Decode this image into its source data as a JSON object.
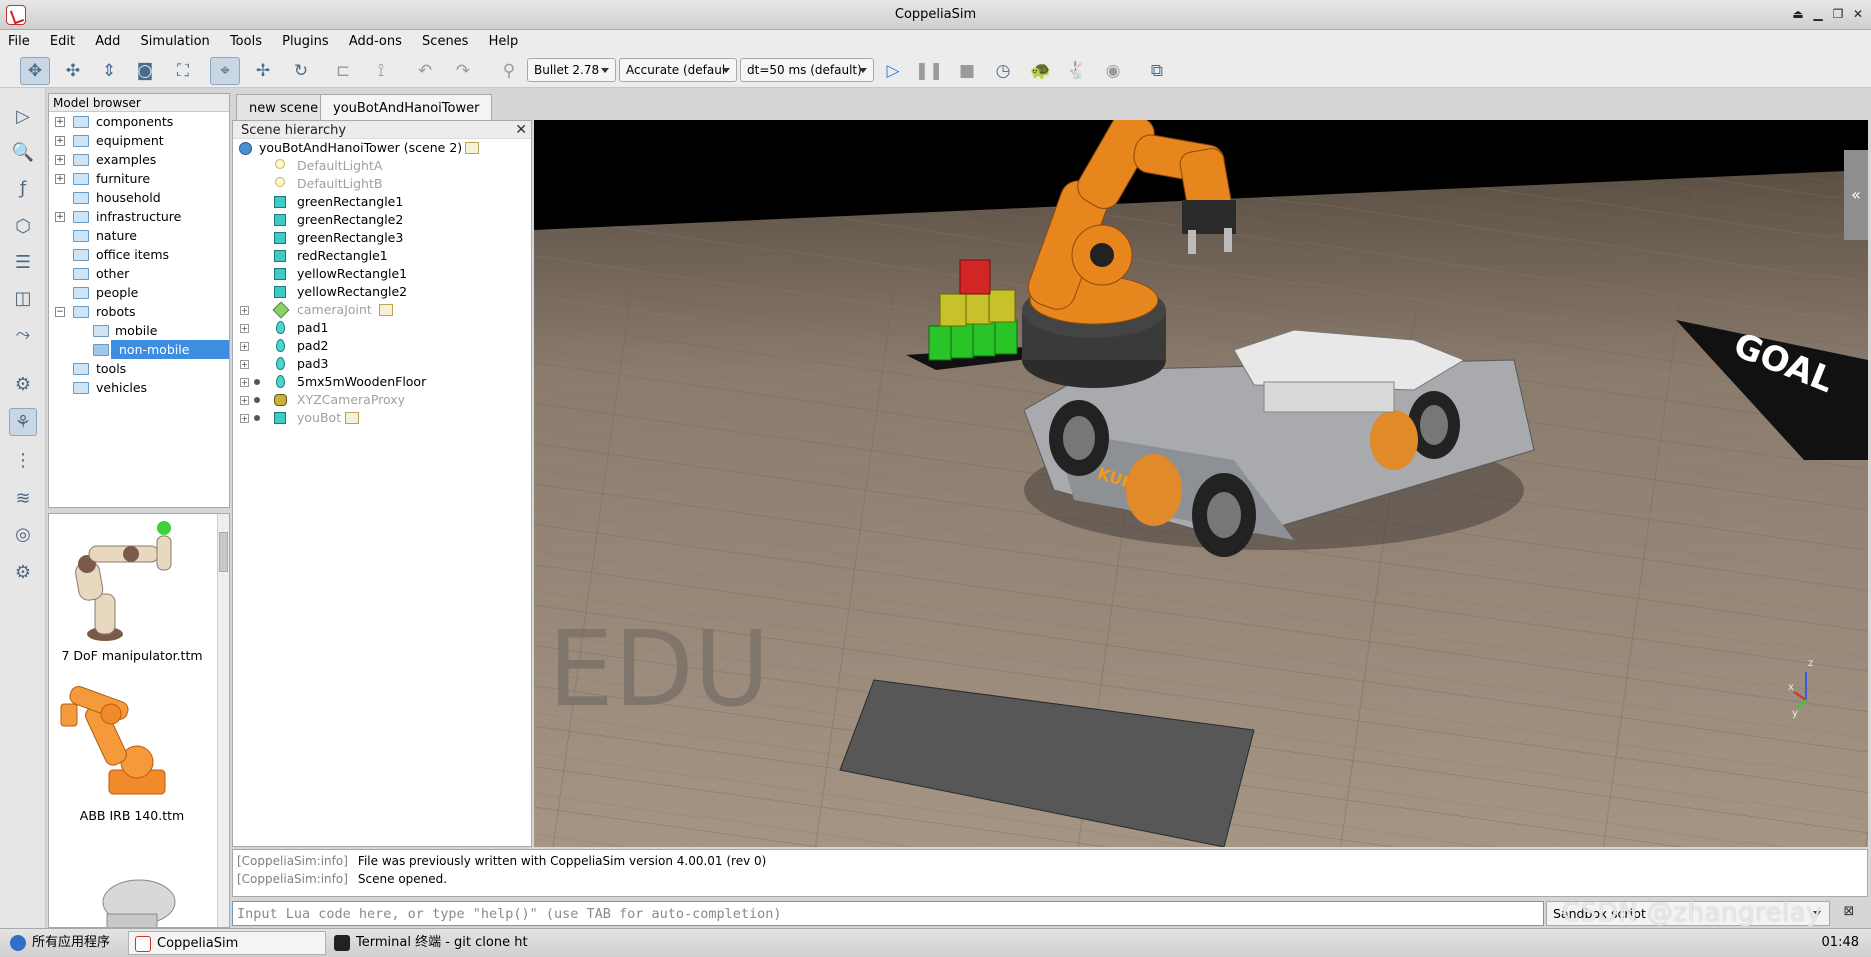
{
  "window": {
    "title": "CoppeliaSim"
  },
  "menu": [
    "File",
    "Edit",
    "Add",
    "Simulation",
    "Tools",
    "Plugins",
    "Add-ons",
    "Scenes",
    "Help"
  ],
  "toolbar": {
    "engine": "Bullet 2.78",
    "accuracy": "Accurate (defaul",
    "dt": "dt=50 ms (default)"
  },
  "model_browser": {
    "title": "Model browser",
    "items": [
      {
        "label": "components",
        "expandable": true
      },
      {
        "label": "equipment",
        "expandable": true
      },
      {
        "label": "examples",
        "expandable": true
      },
      {
        "label": "furniture",
        "expandable": true
      },
      {
        "label": "household",
        "expandable": false
      },
      {
        "label": "infrastructure",
        "expandable": true
      },
      {
        "label": "nature",
        "expandable": false
      },
      {
        "label": "office items",
        "expandable": false
      },
      {
        "label": "other",
        "expandable": false
      },
      {
        "label": "people",
        "expandable": false
      },
      {
        "label": "robots",
        "expandable": true,
        "expanded": true
      },
      {
        "label": "mobile",
        "expandable": false
      },
      {
        "label": "non-mobile",
        "expandable": false,
        "selected": true
      },
      {
        "label": "tools",
        "expandable": false
      },
      {
        "label": "vehicles",
        "expandable": false
      }
    ],
    "thumbnails": [
      "7 DoF manipulator.ttm",
      "ABB IRB 140.ttm"
    ]
  },
  "tabs": [
    "new scene",
    "youBotAndHanoiTower"
  ],
  "scene_hierarchy": {
    "title": "Scene hierarchy",
    "root": "youBotAndHanoiTower (scene 2)",
    "items": [
      {
        "label": "DefaultLightA",
        "icon": "light",
        "dim": true
      },
      {
        "label": "DefaultLightB",
        "icon": "light",
        "dim": true
      },
      {
        "label": "greenRectangle1",
        "icon": "cuboid"
      },
      {
        "label": "greenRectangle2",
        "icon": "cuboid"
      },
      {
        "label": "greenRectangle3",
        "icon": "cuboid"
      },
      {
        "label": "redRectangle1",
        "icon": "cuboid"
      },
      {
        "label": "yellowRectangle1",
        "icon": "cuboid"
      },
      {
        "label": "yellowRectangle2",
        "icon": "cuboid"
      },
      {
        "label": "cameraJoint",
        "icon": "joint",
        "dim": true,
        "expandable": true,
        "script": true
      },
      {
        "label": "pad1",
        "icon": "shape",
        "expandable": true
      },
      {
        "label": "pad2",
        "icon": "shape",
        "expandable": true
      },
      {
        "label": "pad3",
        "icon": "shape",
        "expandable": true
      },
      {
        "label": "5mx5mWoodenFloor",
        "icon": "shape",
        "expandable": true
      },
      {
        "label": "XYZCameraProxy",
        "icon": "camera",
        "dim": true,
        "expandable": true
      },
      {
        "label": "youBot",
        "icon": "cuboid",
        "dim": true,
        "expandable": true,
        "script": true
      }
    ]
  },
  "viewport": {
    "watermark": "EDU",
    "goal_label": "GOAL",
    "kuka_label": "KUKA",
    "axis_z": "z",
    "axis_x": "x",
    "axis_y": "y"
  },
  "console": {
    "lines": [
      {
        "tag": "[CoppeliaSim:info]",
        "text": "File was previously written with CoppeliaSim version 4.00.01 (rev 0)"
      },
      {
        "tag": "[CoppeliaSim:info]",
        "text": "Scene opened."
      }
    ],
    "input_placeholder": "Input Lua code here, or type \"help()\" (use TAB for auto-completion)",
    "script_select": "Sandbox script"
  },
  "taskbar": {
    "start": "所有应用程序",
    "tasks": [
      "CoppeliaSim",
      "Terminal 终端 - git clone htt…"
    ],
    "clock": "01:48"
  },
  "watermark": "CSDN @zhangrelay"
}
